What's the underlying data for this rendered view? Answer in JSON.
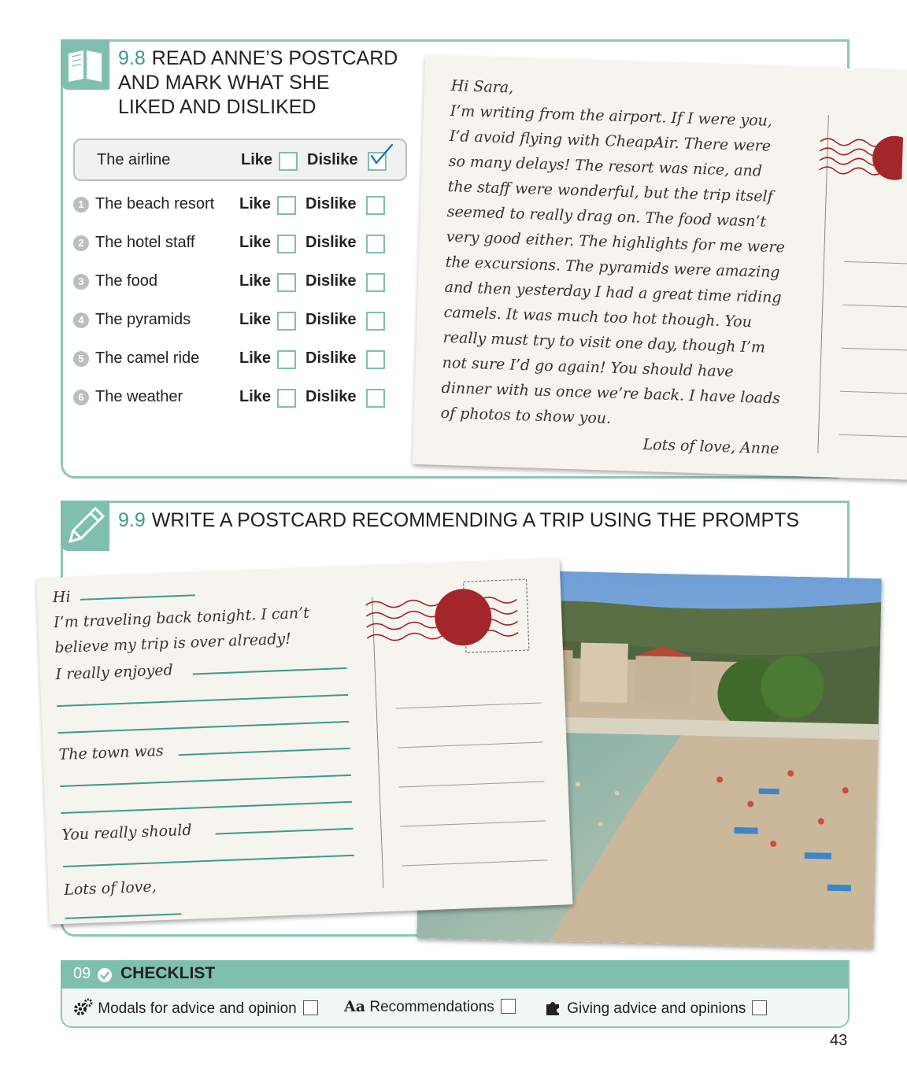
{
  "section_read": {
    "number": "9.8",
    "title_lines": [
      "READ ANNE’S POSTCARD",
      "AND MARK WHAT SHE",
      "LIKED AND DISLIKED"
    ],
    "like_label": "Like",
    "dislike_label": "Dislike",
    "example": {
      "label": "The airline",
      "check": "✓"
    },
    "items": [
      {
        "num": "1",
        "label": "The beach resort"
      },
      {
        "num": "2",
        "label": "The hotel staff"
      },
      {
        "num": "3",
        "label": "The food"
      },
      {
        "num": "4",
        "label": "The pyramids"
      },
      {
        "num": "5",
        "label": "The camel ride"
      },
      {
        "num": "6",
        "label": "The weather"
      }
    ]
  },
  "postcard_anne": {
    "lines": [
      "Hi Sara,",
      "I’m writing from the airport. If I were you,",
      "I’d avoid flying with CheapAir. There were",
      "so many delays! The resort was nice, and",
      "the staff were wonderful, but the trip itself",
      "seemed to really drag on. The food wasn’t",
      "very good either. The highlights for me were",
      "the excursions. The pyramids were amazing",
      "and then yesterday I had a great time riding",
      "camels. It was much too hot though. You",
      "really must try to visit one day, though I’m",
      "not sure I’d go again! You should have",
      "dinner with us once we’re back. I have loads",
      "of photos to show you."
    ],
    "signoff": "Lots of love, Anne"
  },
  "section_write": {
    "number": "9.9",
    "title": "WRITE A POSTCARD RECOMMENDING A TRIP USING THE PROMPTS",
    "prompts": {
      "hi": "Hi",
      "line1": "I’m traveling back tonight. I can’t",
      "line2": "believe my trip is over already!",
      "enjoyed": "I really enjoyed",
      "town": "The town was",
      "should": "You really should",
      "love": "Lots of love,"
    }
  },
  "checklist": {
    "unit": "09",
    "title": "CHECKLIST",
    "items": [
      {
        "icon": "gears-icon",
        "label": "Modals for advice and opinion"
      },
      {
        "icon": "Aa",
        "label": "Recommendations"
      },
      {
        "icon": "puzzle-icon",
        "label": "Giving advice and opinions"
      }
    ]
  },
  "page_number": "43",
  "colors": {
    "accent": "#7fbfae",
    "accent_dark": "#3e9a86",
    "stamp": "#a3262a"
  }
}
